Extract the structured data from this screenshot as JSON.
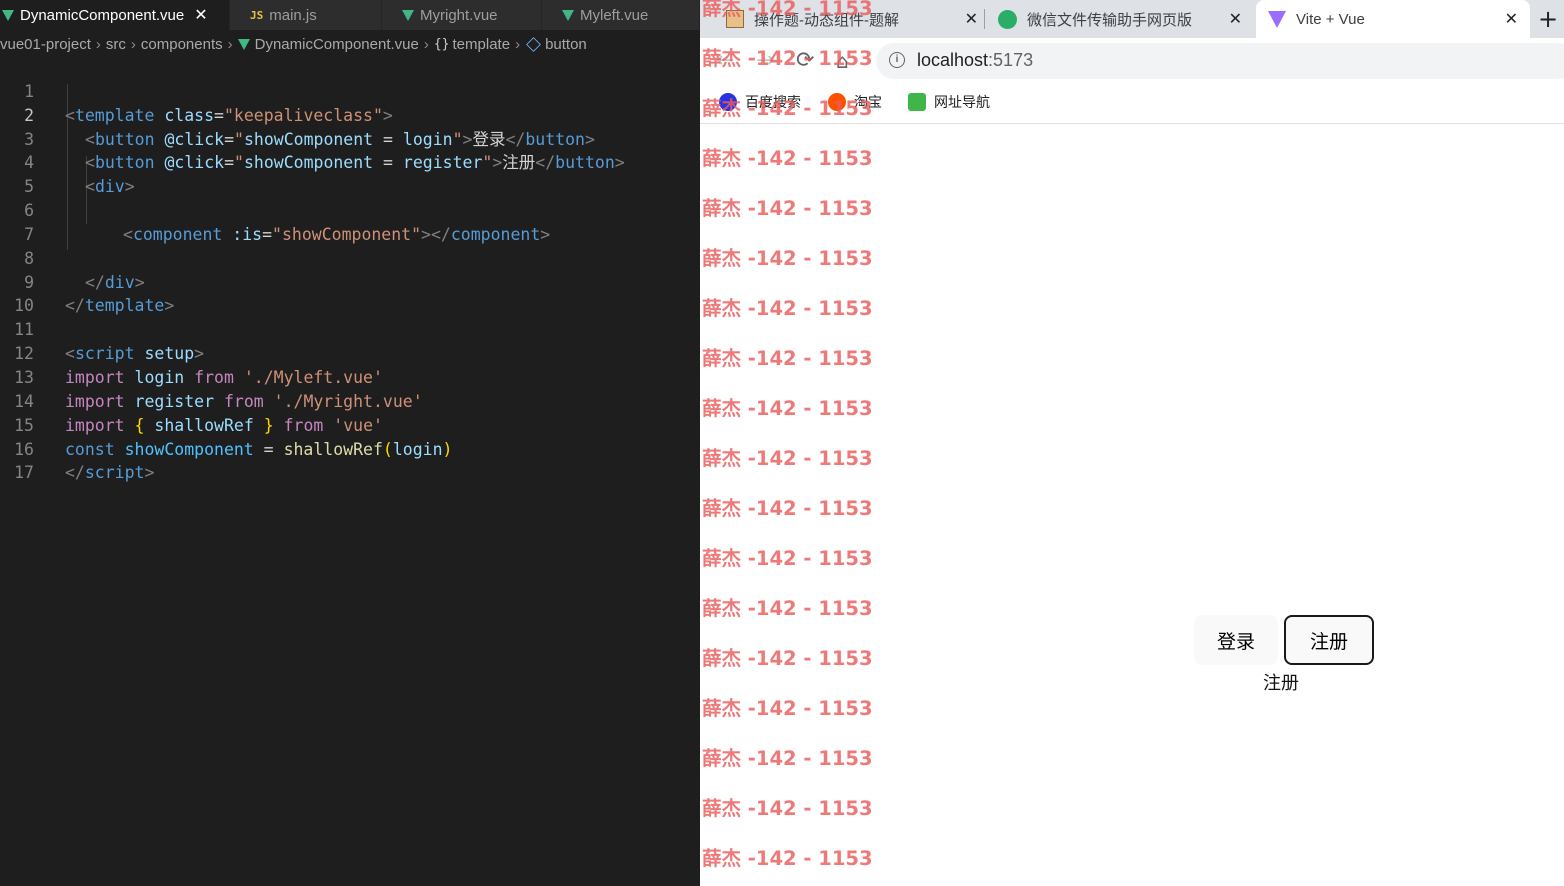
{
  "editor": {
    "tabs": [
      {
        "label": "DynamicComponent.vue",
        "active": true,
        "icon": "vue-icon"
      },
      {
        "label": "main.js",
        "active": false,
        "icon": "js-icon"
      },
      {
        "label": "Myright.vue",
        "active": false,
        "icon": "vue-icon"
      },
      {
        "label": "Myleft.vue",
        "active": false,
        "icon": "vue-icon"
      }
    ],
    "js_badge": "JS",
    "close_glyph": "✕",
    "breadcrumb": [
      "vue01-project",
      "src",
      "components",
      "DynamicComponent.vue",
      "template",
      "button"
    ],
    "current_line": 2,
    "line_numbers": [
      "1",
      "2",
      "3",
      "4",
      "5",
      "6",
      "7",
      "8",
      "9",
      "10",
      "11",
      "12",
      "13",
      "14",
      "15",
      "16",
      "17"
    ],
    "colors": {
      "background": "#1e1e1e",
      "tag": "#569cd6",
      "attr": "#9cdcfe",
      "string": "#ce9178",
      "keyword": "#c586c0",
      "function": "#dcdcaa"
    }
  },
  "code": {
    "l1": {
      "a": "<",
      "b": "template",
      "c": " class",
      "d": "=",
      "e": "\"keepaliveclass\"",
      "f": ">"
    },
    "l2": {
      "a": "<",
      "b": "button",
      "c": " @click",
      "d": "=",
      "e": "\"",
      "f": "showComponent",
      "g": " = ",
      "h": "login",
      "i": "\"",
      "j": ">",
      "k": "登录",
      "l": "</",
      "m": "button",
      "n": ">"
    },
    "l3": {
      "a": "<",
      "b": "button",
      "c": " @click",
      "d": "=",
      "e": "\"",
      "f": "showComponent",
      "g": " = ",
      "h": "register",
      "i": "\"",
      "j": ">",
      "k": "注册",
      "l": "</",
      "m": "button",
      "n": ">"
    },
    "l4": {
      "a": "<",
      "b": "div",
      "c": ">"
    },
    "l6": {
      "a": "<",
      "b": "component",
      "c": " :is",
      "d": "=",
      "e": "\"",
      "f": "showComponent",
      "g": "\"",
      "h": "></",
      "i": "component",
      "j": ">"
    },
    "l8": {
      "a": "</",
      "b": "div",
      "c": ">"
    },
    "l9": {
      "a": "</",
      "b": "template",
      "c": ">"
    },
    "l11": {
      "a": "<",
      "b": "script",
      "c": " setup",
      "d": ">"
    },
    "l12": {
      "a": "import",
      "b": " login ",
      "c": "from",
      "d": " './Myleft.vue'"
    },
    "l13": {
      "a": "import",
      "b": " register ",
      "c": "from",
      "d": " './Myright.vue'"
    },
    "l14": {
      "a": "import",
      "b": " { ",
      "c": "shallowRef",
      "d": " } ",
      "e": "from",
      "f": " 'vue'"
    },
    "l15": {
      "a": "const",
      "b": " showComponent",
      "c": " = ",
      "d": "shallowRef",
      "e": "(",
      "f": "login",
      "g": ")"
    },
    "l16": {
      "a": "</",
      "b": "script",
      "c": ">"
    }
  },
  "browser": {
    "tabs": [
      {
        "label": "操作题-动态组件-题解",
        "icon": "document-favicon-icon"
      },
      {
        "label": "微信文件传输助手网页版",
        "icon": "wechat-favicon-icon"
      },
      {
        "label": "Vite + Vue",
        "icon": "vite-favicon-icon",
        "active": true
      }
    ],
    "new_tab_glyph": "+",
    "nav": {
      "back": "←",
      "forward": "→",
      "reload": "⟳",
      "home": "⌂"
    },
    "address": {
      "host": "localhost",
      "port": ":5173"
    },
    "info_glyph": "i",
    "bookmarks": [
      {
        "label": "百度搜索",
        "icon": "baidu-icon"
      },
      {
        "label": "淘宝",
        "icon": "taobao-icon"
      },
      {
        "label": "网址导航",
        "icon": "nav-site-icon"
      }
    ],
    "watermark_text": "薛杰 -142 - 1153",
    "watermark_color": "#ea5c5c",
    "demo": {
      "login_label": "登录",
      "register_label": "注册",
      "component_output": "注册"
    }
  }
}
